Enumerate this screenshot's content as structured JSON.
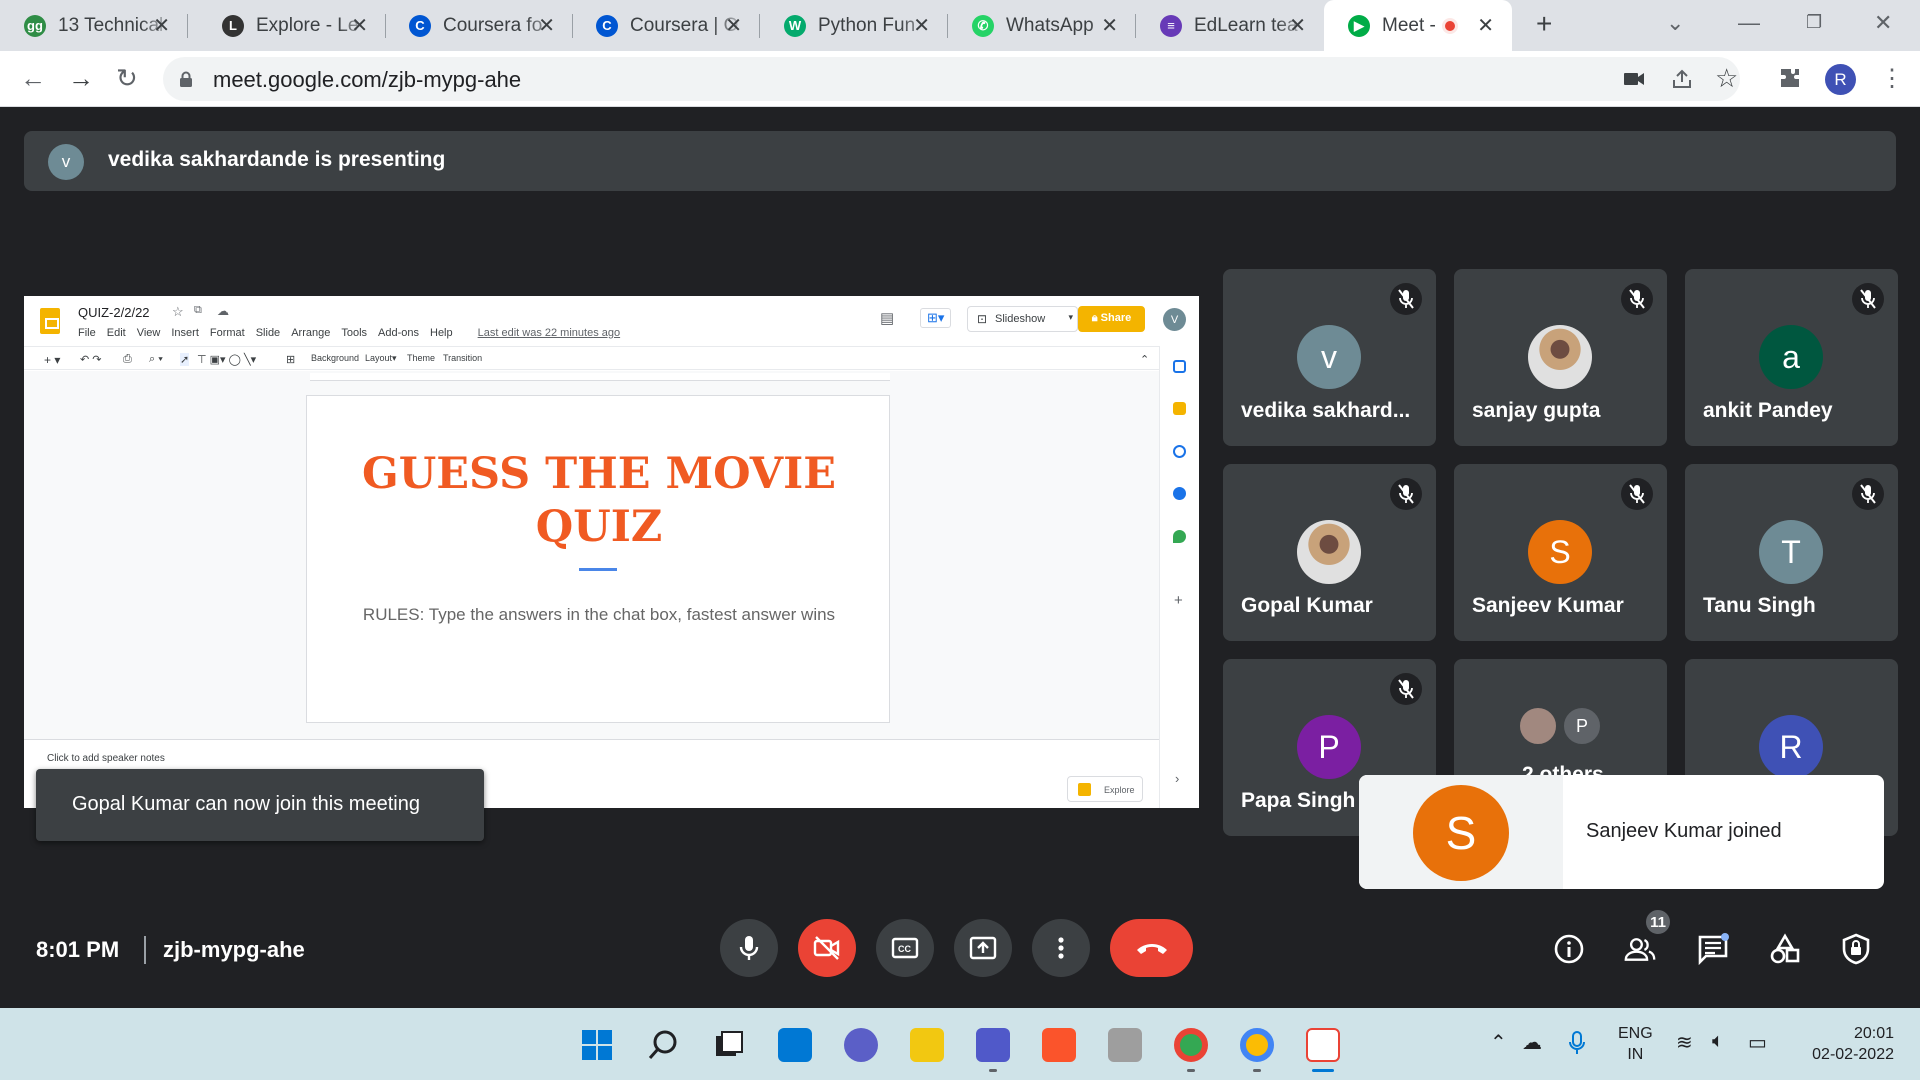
{
  "browser": {
    "tabs": [
      {
        "title": "13 Technical",
        "icon": "geeksforgeeks-icon",
        "color": "#2f8d46",
        "glyph": "gg"
      },
      {
        "title": "Explore - Le",
        "icon": "leetcode-icon",
        "color": "#333333",
        "glyph": "L"
      },
      {
        "title": "Coursera fo",
        "icon": "coursera-icon",
        "color": "#0056d2",
        "glyph": "C"
      },
      {
        "title": "Coursera | O",
        "icon": "coursera-icon",
        "color": "#0056d2",
        "glyph": "C"
      },
      {
        "title": "Python Fun",
        "icon": "w3schools-icon",
        "color": "#04aa6d",
        "glyph": "W"
      },
      {
        "title": "WhatsApp",
        "icon": "whatsapp-icon",
        "color": "#25d366",
        "glyph": "✆"
      },
      {
        "title": "EdLearn tea",
        "icon": "forms-icon",
        "color": "#673ab7",
        "glyph": "≡"
      },
      {
        "title": "Meet -",
        "icon": "meet-icon",
        "color": "#00ac47",
        "glyph": "▶"
      }
    ],
    "url": "meet.google.com/zjb-mypg-ahe",
    "profile_initial": "R"
  },
  "meet": {
    "presenter_initial": "v",
    "presenting_text": "vedika sakhardande is presenting",
    "slides": {
      "doc_title": "QUIZ-2/2/22",
      "menu": [
        "File",
        "Edit",
        "View",
        "Insert",
        "Format",
        "Slide",
        "Arrange",
        "Tools",
        "Add-ons",
        "Help"
      ],
      "last_edit": "Last edit was 22 minutes ago",
      "slideshow_label": "Slideshow",
      "share_label": "Share",
      "user_initial": "V",
      "toolbar": {
        "background": "Background",
        "layout": "Layout▾",
        "theme": "Theme",
        "transition": "Transition"
      },
      "slide_heading": "GUESS THE MOVIE QUIZ",
      "slide_rules": "RULES: Type the answers in the chat box, fastest answer wins",
      "notes_placeholder": "Click to add speaker notes",
      "explore_label": "Explore"
    },
    "participants": [
      {
        "name": "vedika sakhard...",
        "initial": "v",
        "color": "#6e8b95",
        "photo": false
      },
      {
        "name": "sanjay gupta",
        "initial": "",
        "color": "#b08968",
        "photo": true
      },
      {
        "name": "ankit Pandey",
        "initial": "a",
        "color": "#00573f",
        "photo": false
      },
      {
        "name": "Gopal Kumar",
        "initial": "",
        "color": "#8d6e63",
        "photo": true
      },
      {
        "name": "Sanjeev Kumar",
        "initial": "S",
        "color": "#e8710a",
        "photo": false
      },
      {
        "name": "Tanu Singh",
        "initial": "T",
        "color": "#6e8b95",
        "photo": false
      },
      {
        "name": "Papa Singh",
        "initial": "P",
        "color": "#7b1fa2",
        "photo": false
      },
      {
        "name": "2 others",
        "initial": "P",
        "color": "#5f6368",
        "photo": false
      },
      {
        "name": "",
        "initial": "R",
        "color": "#3f51b5",
        "photo": false
      }
    ],
    "toast_admit": "Gopal Kumar can now join this meeting",
    "toast_joined": "Sanjeev Kumar joined",
    "toast_joined_initial": "S",
    "time": "8:01 PM",
    "meeting_code": "zjb-mypg-ahe",
    "participant_count": "11"
  },
  "taskbar": {
    "lang_line1": "ENG",
    "lang_line2": "IN",
    "clock_time": "20:01",
    "clock_date": "02-02-2022"
  }
}
